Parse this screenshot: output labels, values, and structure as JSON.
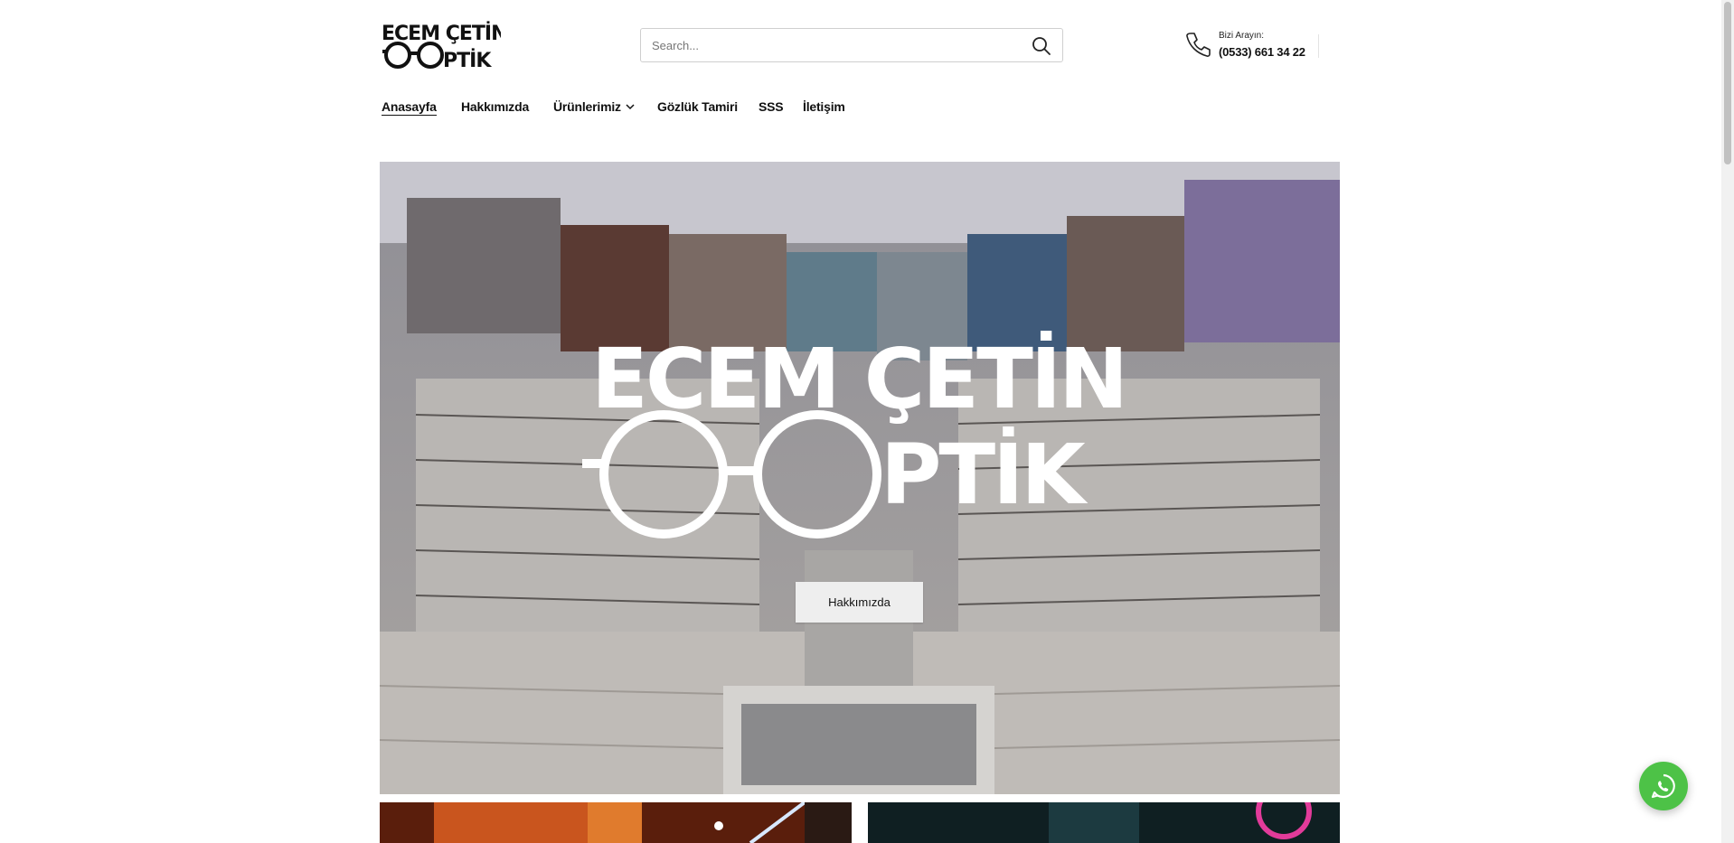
{
  "header": {
    "logo_text": "ECEM ÇETİN OPTİK",
    "search": {
      "placeholder": "Search...",
      "value": ""
    },
    "contact": {
      "label": "Bizi Arayın:",
      "phone": "(0533) 661 34 22"
    }
  },
  "nav": {
    "items": [
      {
        "label": "Anasayfa",
        "active": true
      },
      {
        "label": "Hakkımızda",
        "active": false
      },
      {
        "label": "Ürünlerimiz",
        "active": false,
        "has_dropdown": true
      },
      {
        "label": "Gözlük Tamiri",
        "active": false
      },
      {
        "label": "SSS",
        "active": false
      },
      {
        "label": "İletişim",
        "active": false
      }
    ]
  },
  "hero": {
    "logo_text": "ECEM ÇETİN OPTİK",
    "button_label": "Hakkımızda"
  },
  "floating": {
    "icon": "whatsapp-icon",
    "color": "#4dc247"
  },
  "colors": {
    "text": "#111111",
    "whatsapp": "#4dc247"
  }
}
